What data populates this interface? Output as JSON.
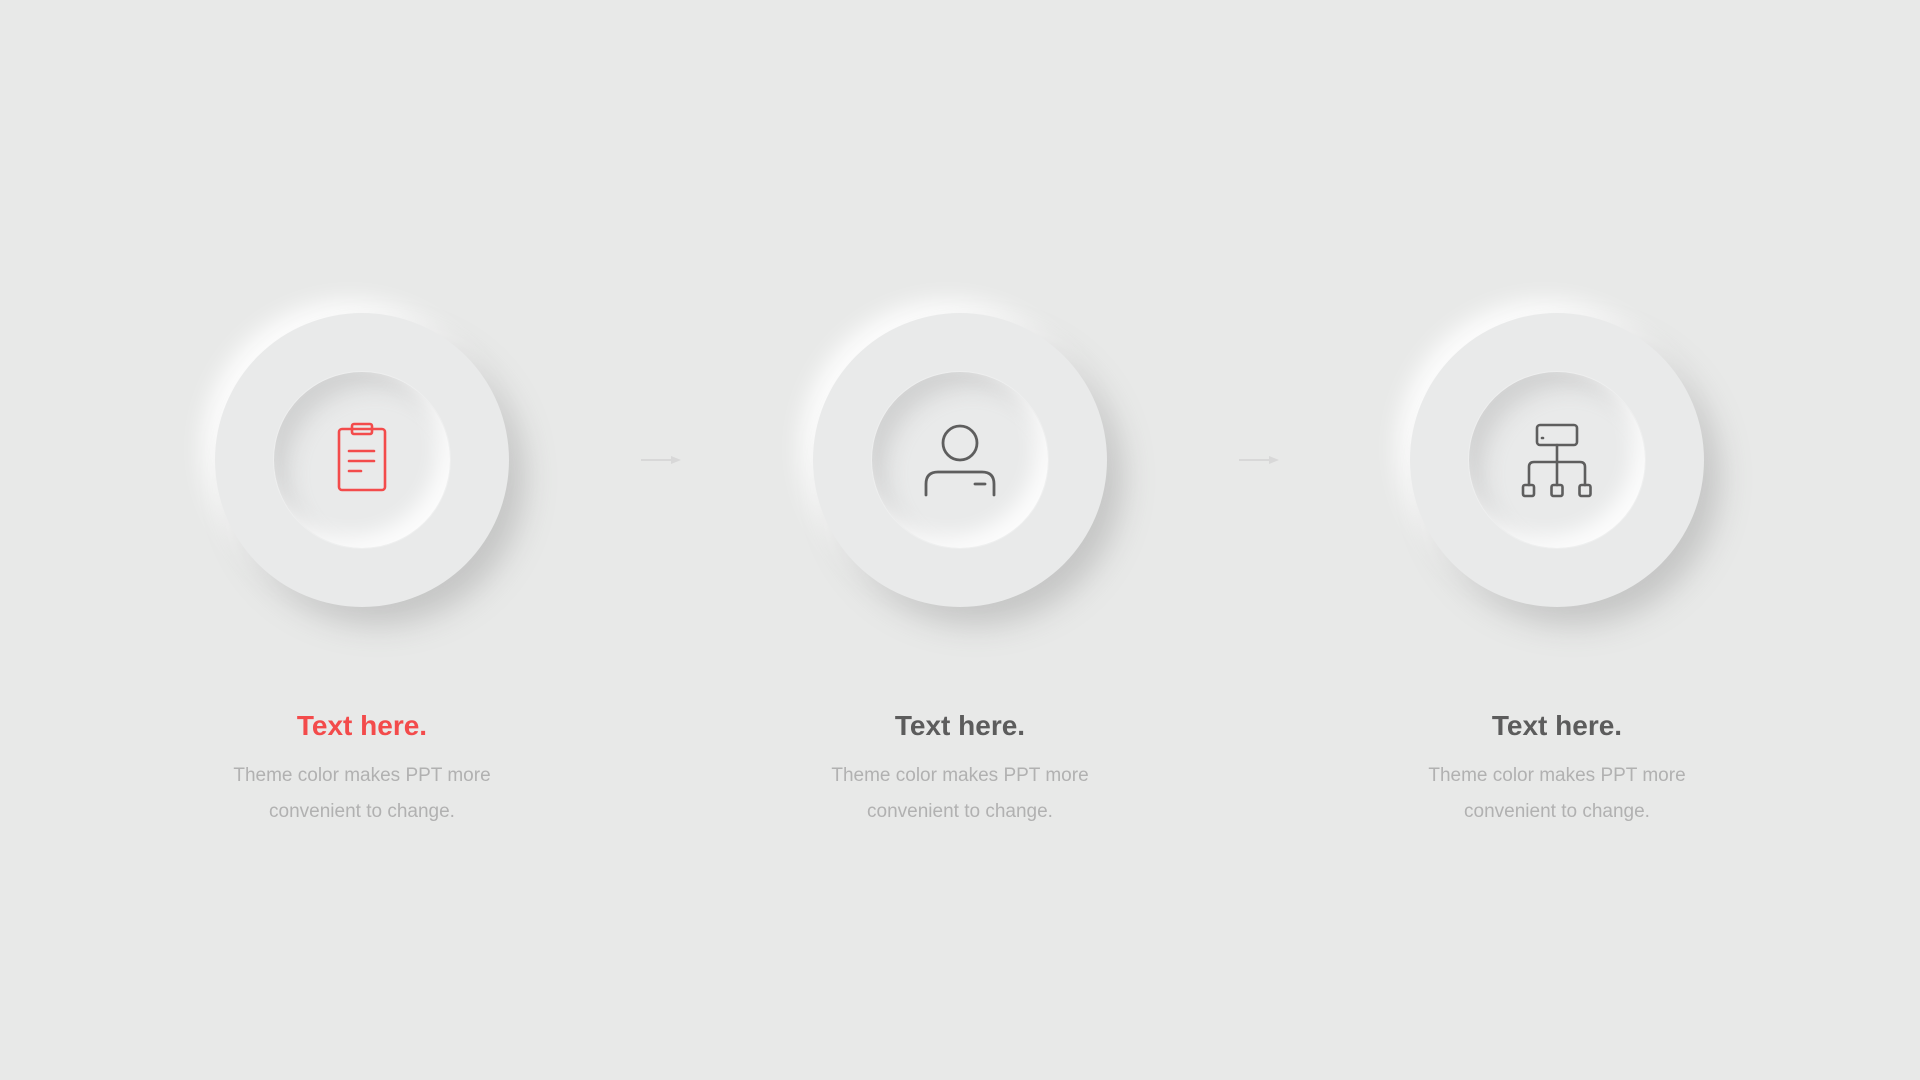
{
  "theme": {
    "background": "#e8e9e8",
    "accent": "#f34b4b",
    "icon_neutral": "#5e5e5e",
    "title_neutral": "#5c5c5c",
    "description": "#b1b1b1"
  },
  "steps": [
    {
      "icon": "clipboard-icon",
      "title": "Text here.",
      "description": "Theme color makes PPT more convenient to change.",
      "active": true
    },
    {
      "icon": "user-icon",
      "title": "Text here.",
      "description": "Theme color makes PPT more convenient to change.",
      "active": false
    },
    {
      "icon": "sitemap-icon",
      "title": "Text here.",
      "description": "Theme color makes PPT more convenient to change.",
      "active": false
    }
  ],
  "connectors": [
    {
      "icon": "arrow-right-icon"
    },
    {
      "icon": "arrow-right-icon"
    }
  ]
}
